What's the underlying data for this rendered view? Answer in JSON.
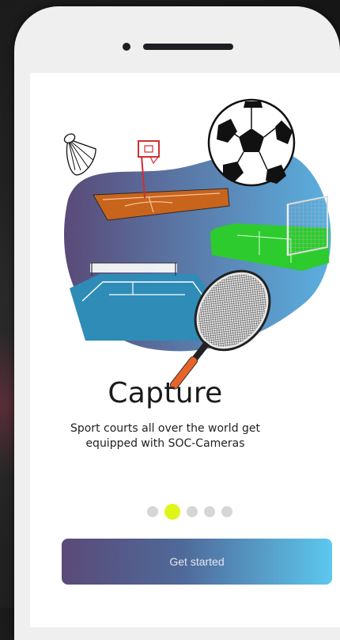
{
  "onboarding": {
    "title": "Capture",
    "subtitle": "Sport courts all over the world get equipped with SOC-Cameras",
    "cta_label": "Get started",
    "pagination": {
      "total": 5,
      "active_index": 1
    }
  },
  "colors": {
    "accent_dot": "#dff51a",
    "cta_gradient_start": "#5a4a78",
    "cta_gradient_end": "#5cc8ee",
    "blob_gradient_start": "#5a4a78",
    "blob_gradient_end": "#5ab0e0"
  },
  "illustration": {
    "icons": [
      "shuttlecock-icon",
      "basketball-hoop-icon",
      "soccer-ball-icon",
      "soccer-goal-icon",
      "tennis-racket-icon"
    ]
  }
}
